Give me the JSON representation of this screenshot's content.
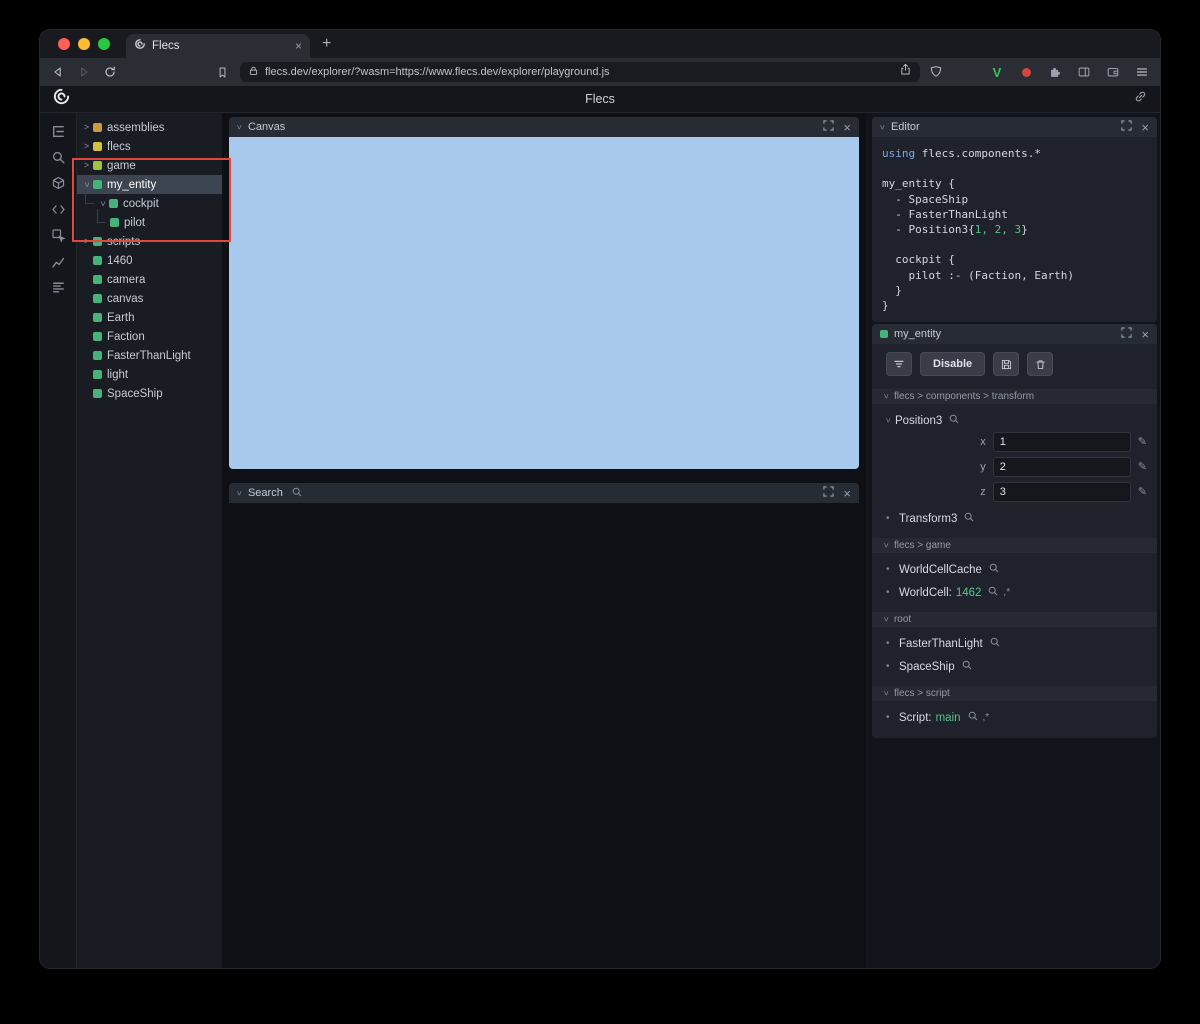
{
  "browser": {
    "tab_title": "Flecs",
    "url": "flecs.dev/explorer/?wasm=https://www.flecs.dev/explorer/playground.js"
  },
  "app": {
    "title": "Flecs"
  },
  "rail_icons": [
    "entity-tree",
    "search",
    "modules-cube",
    "code",
    "inspect",
    "stats-chart",
    "data-rows"
  ],
  "tree": {
    "items": [
      {
        "label": "assemblies",
        "color": "#cf9a3e",
        "state": "collapsed",
        "depth": 0,
        "selected": false
      },
      {
        "label": "flecs",
        "color": "#cfc33e",
        "state": "collapsed",
        "depth": 0,
        "selected": false
      },
      {
        "label": "game",
        "color": "#9fc33e",
        "state": "collapsed",
        "depth": 0,
        "selected": false
      },
      {
        "label": "my_entity",
        "color": "#46b37a",
        "state": "expanded",
        "depth": 0,
        "selected": true
      },
      {
        "label": "cockpit",
        "color": "#46b37a",
        "state": "expanded",
        "depth": 1,
        "selected": false
      },
      {
        "label": "pilot",
        "color": "#46b37a",
        "state": "leaf",
        "depth": 2,
        "selected": false
      },
      {
        "label": "scripts",
        "color": "#46b37a",
        "state": "collapsed",
        "depth": 0,
        "selected": false
      },
      {
        "label": "1460",
        "color": "#46b37a",
        "state": "leaf",
        "depth": 0,
        "selected": false
      },
      {
        "label": "camera",
        "color": "#46b37a",
        "state": "leaf",
        "depth": 0,
        "selected": false
      },
      {
        "label": "canvas",
        "color": "#46b37a",
        "state": "leaf",
        "depth": 0,
        "selected": false
      },
      {
        "label": "Earth",
        "color": "#46b37a",
        "state": "leaf",
        "depth": 0,
        "selected": false
      },
      {
        "label": "Faction",
        "color": "#46b37a",
        "state": "leaf",
        "depth": 0,
        "selected": false
      },
      {
        "label": "FasterThanLight",
        "color": "#46b37a",
        "state": "leaf",
        "depth": 0,
        "selected": false
      },
      {
        "label": "light",
        "color": "#46b37a",
        "state": "leaf",
        "depth": 0,
        "selected": false
      },
      {
        "label": "SpaceShip",
        "color": "#46b37a",
        "state": "leaf",
        "depth": 0,
        "selected": false
      }
    ]
  },
  "canvas_panel": {
    "title": "Canvas"
  },
  "search_panel": {
    "title": "Search"
  },
  "editor": {
    "title": "Editor",
    "code": {
      "l1a": "using",
      "l1b": " flecs.components.*",
      "l3": "my_entity {",
      "l4": "  - SpaceShip",
      "l5": "  - FasterThanLight",
      "l6a": "  - Position3{",
      "l6b": "1, 2, 3",
      "l6c": "}",
      "l8": "  cockpit {",
      "l9": "    pilot :- (Faction, Earth)",
      "l10": "  }",
      "l11": "}"
    }
  },
  "inspector": {
    "title": "my_entity",
    "disable_label": "Disable",
    "sections": {
      "transform": "flecs > components > transform",
      "game": "flecs > game",
      "root": "root",
      "script": "flecs > script"
    },
    "position3": {
      "name": "Position3",
      "fields": [
        {
          "label": "x",
          "value": "1"
        },
        {
          "label": "y",
          "value": "2"
        },
        {
          "label": "z",
          "value": "3"
        }
      ]
    },
    "transform3": "Transform3",
    "worldcellcache": "WorldCellCache",
    "worldcell": {
      "name": "WorldCell:",
      "value": "1462",
      "suffix": ",*"
    },
    "fasterthanlight": "FasterThanLight",
    "spaceship": "SpaceShip",
    "script": {
      "name": "Script:",
      "value": "main",
      "suffix": ",*"
    }
  },
  "annotation": {
    "type": "highlight-box"
  },
  "colors": {
    "canvas_blue": "#a9c9ec",
    "annotation_red": "#e04a3a",
    "accent_green": "#46b37a",
    "value_green": "#56c28c",
    "code_keyword": "#7fa6e3",
    "code_number": "#56c28c"
  }
}
